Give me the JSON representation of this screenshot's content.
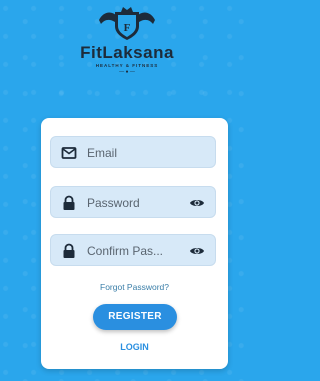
{
  "brand": {
    "name": "FitLaksana",
    "tagline": "HEALTHY & FITNESS",
    "logo_icon": "shield-crest-icon"
  },
  "form": {
    "email": {
      "placeholder": "Email",
      "icon": "mail-icon"
    },
    "password": {
      "placeholder": "Password",
      "icon": "lock-icon",
      "toggle_icon": "eye-icon"
    },
    "confirm": {
      "placeholder": "Confirm Pas...",
      "icon": "lock-icon",
      "toggle_icon": "eye-icon"
    },
    "forgot_label": "Forgot Password?",
    "register_label": "REGISTER",
    "login_label": "LOGIN"
  },
  "colors": {
    "background": "#2aa6ec",
    "field_bg": "#d7e9f8",
    "primary": "#2a8fe0",
    "dark": "#1d2b3a"
  }
}
